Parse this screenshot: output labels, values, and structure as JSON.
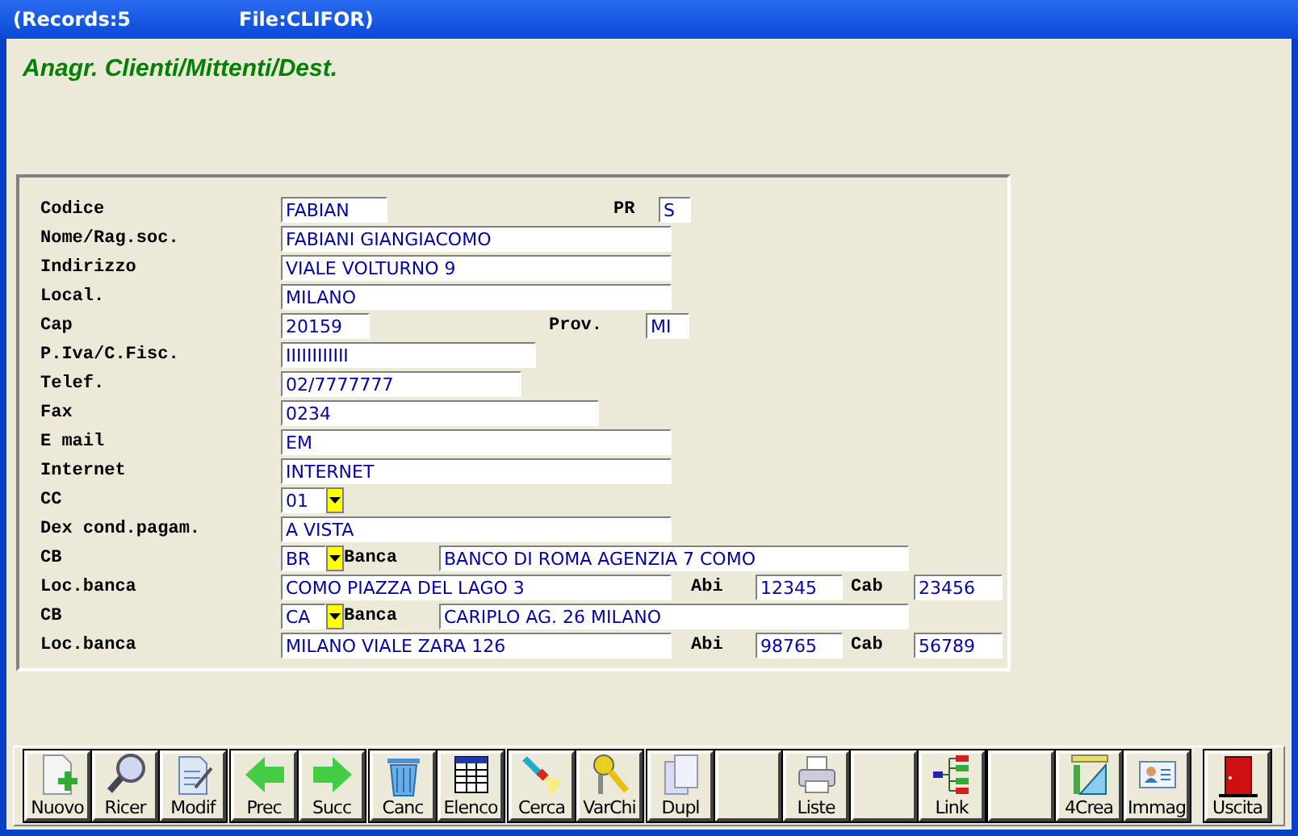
{
  "window": {
    "records": "(Records:5",
    "file": "File:CLIFOR)"
  },
  "heading": "Anagr. Clienti/Mittenti/Dest.",
  "rows": [
    {
      "items": [
        {
          "kind": "label",
          "text": "Codice"
        },
        {
          "kind": "field",
          "value": "FABIAN"
        },
        {
          "kind": "label",
          "text": "PR"
        },
        {
          "kind": "field",
          "value": "S"
        }
      ]
    },
    {
      "items": [
        {
          "kind": "label",
          "text": "Nome/Rag.soc."
        },
        {
          "kind": "field",
          "value": "FABIANI GIANGIACOMO"
        }
      ]
    },
    {
      "items": [
        {
          "kind": "label",
          "text": "Indirizzo"
        },
        {
          "kind": "field",
          "value": "VIALE VOLTURNO 9"
        }
      ]
    },
    {
      "items": [
        {
          "kind": "label",
          "text": "Local."
        },
        {
          "kind": "field",
          "value": "MILANO"
        }
      ]
    },
    {
      "items": [
        {
          "kind": "label",
          "text": "Cap"
        },
        {
          "kind": "field",
          "value": "20159"
        },
        {
          "kind": "label",
          "text": "Prov."
        },
        {
          "kind": "field",
          "value": "MI"
        }
      ]
    },
    {
      "items": [
        {
          "kind": "label",
          "text": "P.Iva/C.Fisc."
        },
        {
          "kind": "field",
          "value": "IIIIIIIIIIII"
        }
      ]
    },
    {
      "items": [
        {
          "kind": "label",
          "text": "Telef."
        },
        {
          "kind": "field",
          "value": "02/7777777"
        }
      ]
    },
    {
      "items": [
        {
          "kind": "label",
          "text": "Fax"
        },
        {
          "kind": "field",
          "value": "0234"
        }
      ]
    },
    {
      "items": [
        {
          "kind": "label",
          "text": "E mail"
        },
        {
          "kind": "field",
          "value": "EM"
        }
      ]
    },
    {
      "items": [
        {
          "kind": "label",
          "text": "Internet"
        },
        {
          "kind": "field",
          "value": "INTERNET"
        }
      ]
    },
    {
      "items": [
        {
          "kind": "label",
          "text": "CC"
        },
        {
          "kind": "combo",
          "value": "01"
        }
      ]
    },
    {
      "items": [
        {
          "kind": "label",
          "text": "Dex cond.pagam."
        },
        {
          "kind": "field",
          "value": "A VISTA"
        }
      ]
    },
    {
      "items": [
        {
          "kind": "label",
          "text": "CB"
        },
        {
          "kind": "combo",
          "value": "BR"
        },
        {
          "kind": "label",
          "text": "Banca"
        },
        {
          "kind": "field",
          "value": "BANCO DI ROMA AGENZIA 7 COMO"
        }
      ]
    },
    {
      "items": [
        {
          "kind": "label",
          "text": "Loc.banca"
        },
        {
          "kind": "field",
          "value": "COMO PIAZZA DEL LAGO 3"
        },
        {
          "kind": "label",
          "text": "Abi"
        },
        {
          "kind": "field",
          "value": "12345"
        },
        {
          "kind": "label",
          "text": "Cab"
        },
        {
          "kind": "field",
          "value": "23456"
        }
      ]
    },
    {
      "items": [
        {
          "kind": "label",
          "text": "CB"
        },
        {
          "kind": "combo",
          "value": "CA"
        },
        {
          "kind": "label",
          "text": "Banca"
        },
        {
          "kind": "field",
          "value": "CARIPLO AG. 26 MILANO"
        }
      ]
    },
    {
      "items": [
        {
          "kind": "label",
          "text": "Loc.banca"
        },
        {
          "kind": "field",
          "value": "MILANO VIALE ZARA 126"
        },
        {
          "kind": "label",
          "text": "Abi"
        },
        {
          "kind": "field",
          "value": "98765"
        },
        {
          "kind": "label",
          "text": "Cab"
        },
        {
          "kind": "field",
          "value": "56789"
        }
      ]
    }
  ],
  "toolbar": [
    {
      "kind": "new",
      "label": "Nuovo"
    },
    {
      "kind": "magnifier",
      "label": "Ricer"
    },
    {
      "kind": "edit",
      "label": "Modif"
    },
    {
      "kind": "prev",
      "label": "Prec"
    },
    {
      "kind": "next",
      "label": "Succ"
    },
    {
      "kind": "trash",
      "label": "Canc"
    },
    {
      "kind": "table",
      "label": "Elenco"
    },
    {
      "kind": "torch",
      "label": "Cerca"
    },
    {
      "kind": "keys",
      "label": "VarChi"
    },
    {
      "kind": "copy",
      "label": "Dupl"
    },
    {
      "kind": "blank"
    },
    {
      "kind": "printer",
      "label": "Liste"
    },
    {
      "kind": "blank"
    },
    {
      "kind": "link",
      "label": "Link"
    },
    {
      "kind": "blank"
    },
    {
      "kind": "tools",
      "label": "4Crea"
    },
    {
      "kind": "card",
      "label": "Immag"
    },
    {
      "kind": "exit",
      "label": "Uscita"
    }
  ]
}
